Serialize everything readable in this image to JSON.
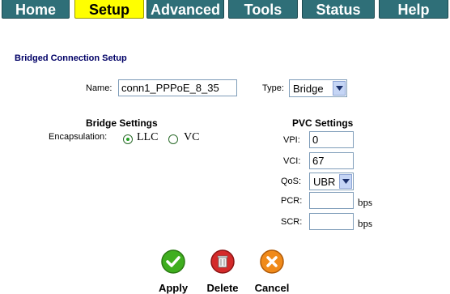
{
  "nav": {
    "tabs": [
      "Home",
      "Setup",
      "Advanced",
      "Tools",
      "Status",
      "Help"
    ],
    "active": "Setup"
  },
  "form": {
    "title": "Bridged Connection Setup",
    "name_label": "Name:",
    "name_value": "conn1_PPPoE_8_35",
    "type_label": "Type:",
    "type_value": "Bridge"
  },
  "bridge": {
    "heading": "Bridge Settings",
    "encap_label": "Encapsulation:",
    "options": [
      "LLC",
      "VC"
    ],
    "selected": "LLC"
  },
  "pvc": {
    "heading": "PVC Settings",
    "vpi_label": "VPI:",
    "vpi_value": "0",
    "vci_label": "VCI:",
    "vci_value": "67",
    "qos_label": "QoS:",
    "qos_value": "UBR",
    "pcr_label": "PCR:",
    "pcr_value": "",
    "scr_label": "SCR:",
    "scr_value": "",
    "unit": "bps"
  },
  "actions": {
    "apply": "Apply",
    "delete": "Delete",
    "cancel": "Cancel"
  },
  "colors": {
    "tab": "#2f6f78",
    "tab_active": "#ffff00",
    "title": "#000066"
  }
}
